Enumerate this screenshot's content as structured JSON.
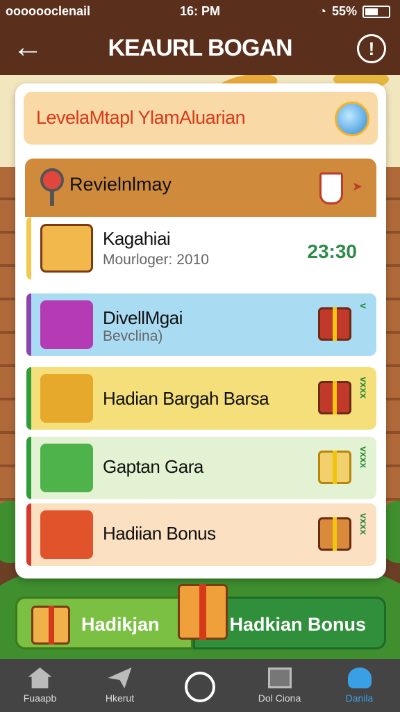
{
  "status_bar": {
    "carrier": "ooooooclenail",
    "time": "16: PM",
    "battery_text": "55%",
    "battery_level_percent": 55
  },
  "header": {
    "title": "KEAURL BOGAN",
    "back_icon": "arrow-left-icon",
    "info_icon": "alert-circle-icon"
  },
  "banner": {
    "text": "LevelaMtapl YlamAluarian",
    "icon": "globe-icon"
  },
  "section": {
    "title": "Revielnlmay",
    "icon": "pin-icon",
    "trophy_icon": "trophy-icon"
  },
  "rows": [
    {
      "title": "Kagahiai",
      "subtitle": "Mourloger: 2010",
      "value": "23:30",
      "icon": "map-icon",
      "color": "#ffffff",
      "stripe": "#f2c94c"
    },
    {
      "title": "DivellMgai",
      "subtitle": "Bevclina)",
      "icon": "gift-icon",
      "color": "#a9dcf3",
      "stripe": "#8e44ad",
      "mark": "v"
    },
    {
      "title": "Hadian Bargah Barsa",
      "subtitle": "",
      "icon": "chest-icon",
      "color": "#f4df7a",
      "stripe": "#2f9d3a",
      "mark": "vxxx"
    },
    {
      "title": "Gaptan Gara",
      "subtitle": "",
      "icon": "pen-icon",
      "color": "#e3f2d2",
      "stripe": "#2f9d3a",
      "mark": "vxxx"
    },
    {
      "title": "Hadiian Bonus",
      "subtitle": "",
      "icon": "book-icon",
      "color": "#fbe0c2",
      "stripe": "#d63a2a",
      "mark": "vxxx"
    }
  ],
  "buttons": {
    "left_label": "Hadikjan",
    "right_label": "Hadkian Bonus"
  },
  "nav": [
    {
      "label": "Fuaapb",
      "icon": "home-icon"
    },
    {
      "label": "Hkerut",
      "icon": "plane-icon"
    },
    {
      "label": "",
      "icon": "circle-icon"
    },
    {
      "label": "Dol Ciona",
      "icon": "photo-icon"
    },
    {
      "label": "Danila",
      "icon": "user-icon"
    }
  ]
}
